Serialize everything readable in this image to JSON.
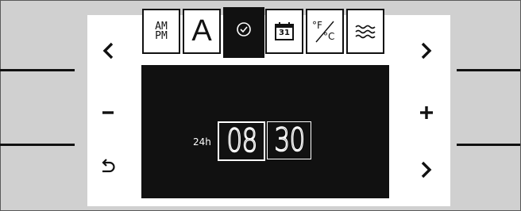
{
  "tabs": [
    {
      "name": "am-pm",
      "label": "AM\nPM",
      "line1": "AM",
      "line2": "PM",
      "active": false
    },
    {
      "name": "auto",
      "label": "A",
      "active": false
    },
    {
      "name": "clock",
      "icon": "clock-icon",
      "active": true
    },
    {
      "name": "calendar",
      "label": "31",
      "active": false
    },
    {
      "name": "temp-unit",
      "label_f": "°F",
      "label_c": "°C",
      "active": false
    },
    {
      "name": "steam",
      "icon": "steam-icon",
      "active": false
    }
  ],
  "display": {
    "format_label": "24h",
    "hours": "08",
    "minutes": "30",
    "selected": "hours"
  },
  "colors": {
    "background": "#d0d0d0",
    "panel": "#ffffff",
    "display": "#111111",
    "segment": "#ffffff"
  }
}
